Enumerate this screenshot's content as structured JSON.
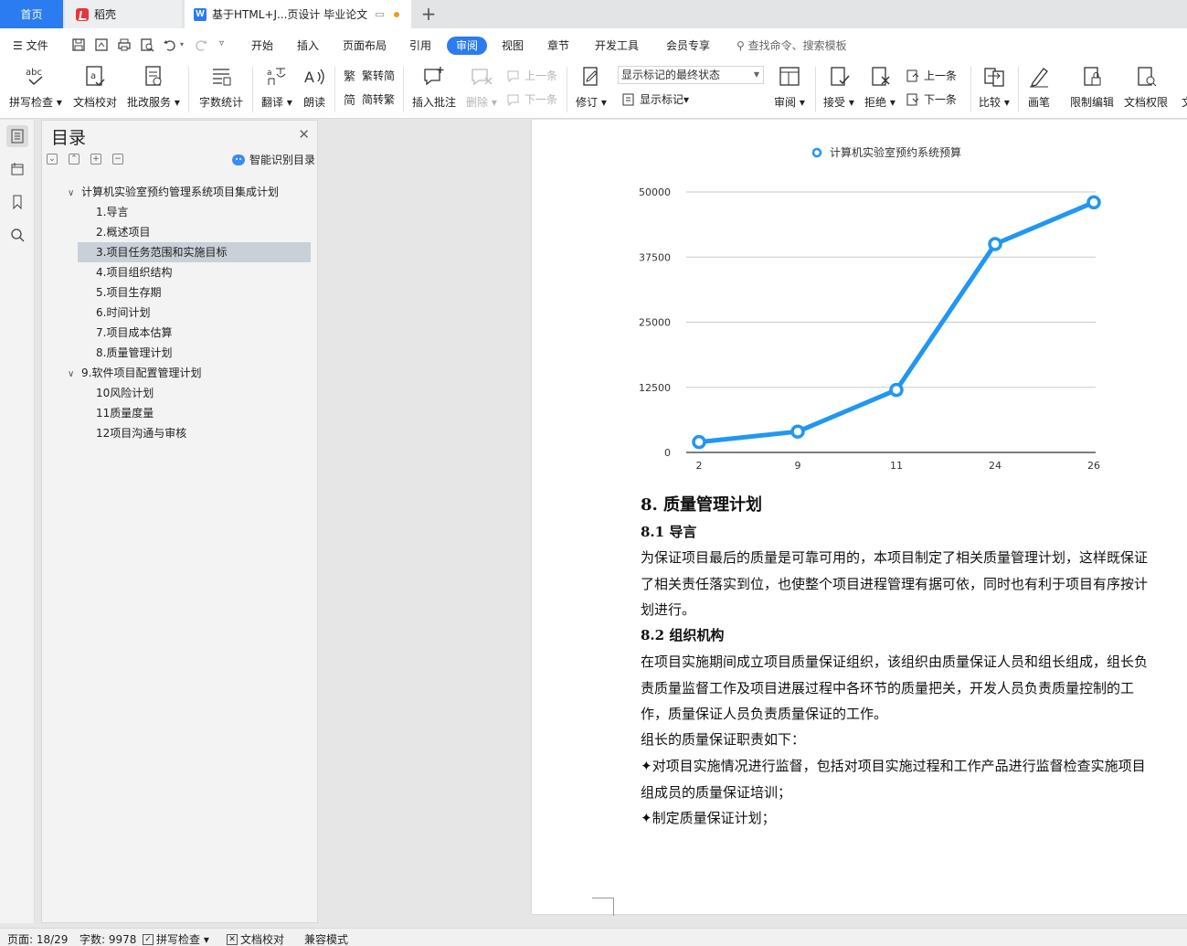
{
  "tabs": [
    {
      "label": "首页"
    },
    {
      "label": "稻壳"
    },
    {
      "label": "基于HTML+J...页设计 毕业论文"
    }
  ],
  "menu": {
    "file": "文件",
    "items": [
      "开始",
      "插入",
      "页面布局",
      "引用",
      "审阅",
      "视图",
      "章节",
      "开发工具",
      "会员专享"
    ],
    "active": "审阅",
    "search_placeholder": "查找命令、搜索模板"
  },
  "ribbon": {
    "spell_check": "拼写检查",
    "doc_proof": "文档校对",
    "batch_service": "批改服务",
    "word_count": "字数统计",
    "translate": "翻译",
    "read_aloud": "朗读",
    "trad_to_simp": "繁转简",
    "simp_to_trad": "简转繁",
    "insert_comment": "插入批注",
    "delete": "删除",
    "prev_comment": "上一条",
    "next_comment": "下一条",
    "revise": "修订",
    "markup_state": "显示标记的最终状态",
    "show_markup": "显示标记",
    "review": "审阅",
    "accept": "接受",
    "reject": "拒绝",
    "prev_change": "上一条",
    "next_change": "下一条",
    "compare": "比较",
    "pen": "画笔",
    "restrict_edit": "限制编辑",
    "doc_permission": "文档权限",
    "more": "文"
  },
  "outline": {
    "title": "目录",
    "smart_toc": "智能识别目录",
    "items": [
      {
        "label": "计算机实验室预约管理系统项目集成计划",
        "level": 1,
        "expanded": true
      },
      {
        "label": "1.导言",
        "level": 2
      },
      {
        "label": "2.概述项目",
        "level": 2
      },
      {
        "label": "3.项目任务范围和实施目标",
        "level": 2,
        "selected": true
      },
      {
        "label": "4.项目组织结构",
        "level": 2
      },
      {
        "label": "5.项目生存期",
        "level": 2
      },
      {
        "label": "6.时间计划",
        "level": 2
      },
      {
        "label": "7.项目成本估算",
        "level": 2
      },
      {
        "label": "8.质量管理计划",
        "level": 2
      },
      {
        "label": "9.软件项目配置管理计划",
        "level": 1,
        "expanded": true
      },
      {
        "label": "10风险计划",
        "level": 2
      },
      {
        "label": "11质量度量",
        "level": 2
      },
      {
        "label": "12项目沟通与审核",
        "level": 2
      }
    ]
  },
  "chart_data": {
    "type": "line",
    "x": [
      "2",
      "9",
      "11",
      "24",
      "26"
    ],
    "series": [
      {
        "name": "计算机实验室预约系统预算",
        "values": [
          2000,
          4000,
          12000,
          40000,
          48000
        ],
        "color": "#2196f3"
      }
    ],
    "yticks": [
      0,
      12500,
      25000,
      37500,
      50000
    ],
    "ylim": [
      0,
      50000
    ],
    "legend": "top-center",
    "grid": true
  },
  "document": {
    "sec8": "8. 质量管理计划",
    "sec81": "8.1 导言",
    "para1": "为保证项目最后的质量是可靠可用的，本项目制定了相关质量管理计划，这样既保证了相关责任落实到位，也使整个项目进程管理有据可依，同时也有利于项目有序按计划进行。",
    "sec82": "8.2 组织机构",
    "para2": "在项目实施期间成立项目质量保证组织，该组织由质量保证人员和组长组成，组长负责质量监督工作及项目进展过程中各环节的质量把关，开发人员负责质量控制的工作，质量保证人员负责质量保证的工作。",
    "para3": "组长的质量保证职责如下：",
    "bullet1": "✦对项目实施情况进行监督，包括对项目实施过程和工作产品进行监督检查实施项目组成员的质量保证培训；",
    "bullet2": "✦制定质量保证计划；"
  },
  "status": {
    "page": "页面: 18/29",
    "words": "字数: 9978",
    "spell": "拼写检查",
    "proof": "文档校对",
    "compat": "兼容模式"
  }
}
